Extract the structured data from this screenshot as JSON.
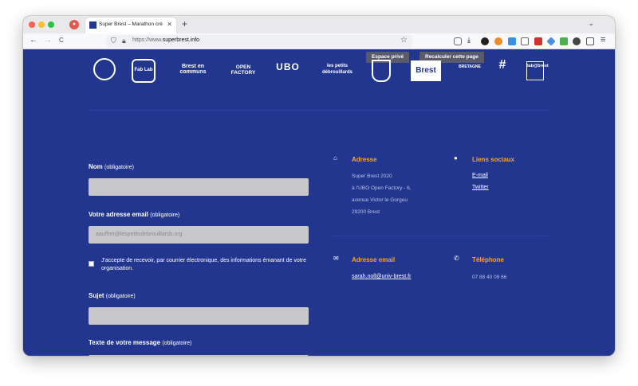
{
  "browser": {
    "tab_title": "Super Brest – Marathon créatif",
    "tab_close": "✕",
    "new_tab": "+",
    "tab_menu": "⌄",
    "url_prefix": "https://www.",
    "url_domain": "superbrest.info",
    "nav": {
      "back": "←",
      "forward": "→",
      "reload": "C"
    },
    "star": "☆",
    "menu": "≡"
  },
  "page": {
    "top_buttons": {
      "private": "Espace privé",
      "recalc": "Recalculer cette page"
    },
    "logos": [
      "Fab Lab",
      "Brest en communs",
      "OPEN FACTORY",
      "UBO",
      "les petits débrouillards",
      "Brest",
      "BRETAGNE",
      "Tag",
      "lab@brest"
    ],
    "form": {
      "name_label": "Nom",
      "name_hint": "(obligatoire)",
      "email_label": "Votre adresse email",
      "email_hint": "(obligatoire)",
      "email_placeholder": "aauffret@lespetitsdebrouillards.org",
      "consent": "J'accepte de recevoir, par courrier électronique, des informations émanant de votre organisation.",
      "subject_label": "Sujet",
      "subject_hint": "(obligatoire)",
      "message_label": "Texte de votre message",
      "message_hint": "(obligatoire)"
    },
    "contact": {
      "address_title": "Adresse",
      "address_lines": [
        "Super Brest 2020",
        "à l'UBO Open Factory - 6,",
        "avenue Victor le Gorgeu",
        "29200 Brest"
      ],
      "social_title": "Liens sociaux",
      "social_links": [
        "E-mail",
        "Twitter"
      ],
      "email_title": "Adresse email",
      "email_value": "sarah.noll@univ-brest.fr",
      "phone_title": "Téléphone",
      "phone_value": "07 88 40 09 66"
    }
  }
}
